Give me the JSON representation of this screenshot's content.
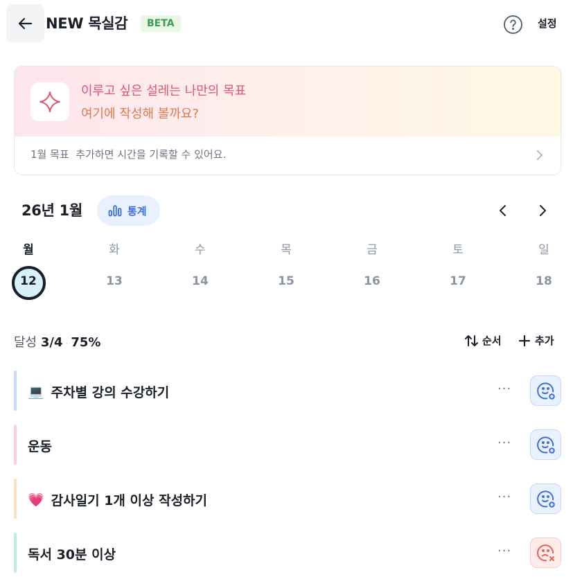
{
  "header": {
    "back_icon": "arrow-left-icon",
    "title": "NEW 목실감",
    "badge": "BETA",
    "help_icon": "question-circle-icon",
    "settings_label": "설정"
  },
  "banner": {
    "icon": "sparkle-icon",
    "line1": "이루고 싶은 설레는 나만의 목표",
    "line2": "여기에 작성해 볼까요?",
    "sub": "1월 목표  추가하면 시간을 기록할 수 있어요.",
    "colors": {
      "line1": "#e0566c",
      "line2": "#e07a4a"
    }
  },
  "calendar": {
    "month_label": "26년 1월",
    "stats_label": "통계",
    "weekdays": [
      "월",
      "화",
      "수",
      "목",
      "금",
      "토",
      "일"
    ],
    "dates": [
      "12",
      "13",
      "14",
      "15",
      "16",
      "17",
      "18"
    ],
    "selected_index": 0
  },
  "progress": {
    "label": "달성",
    "count": "3/4",
    "percent": "75%",
    "sort_label": "순서",
    "add_label": "추가"
  },
  "goals": [
    {
      "emoji": "💻",
      "label": "주차별 강의 수강하기",
      "color": "#c9dafb",
      "status": "done"
    },
    {
      "emoji": "",
      "label": "운동",
      "color": "#f9cfe0",
      "status": "done"
    },
    {
      "emoji": "💗",
      "label": "감사일기 1개 이상 작성하기",
      "color": "#fde0c4",
      "status": "done"
    },
    {
      "emoji": "",
      "label": "독서 30분 이상",
      "color": "#c4ecd9",
      "status": "failed"
    }
  ],
  "more_label": "···",
  "accent": "#3a6fe0"
}
